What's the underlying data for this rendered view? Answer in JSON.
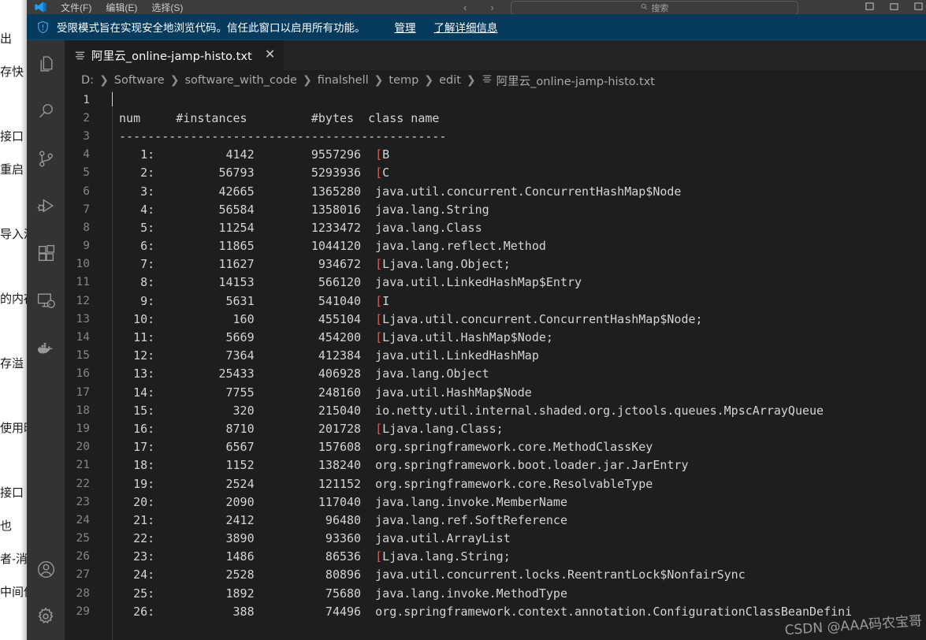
{
  "background_window": {
    "fragments": [
      "出",
      "存快",
      "",
      "接口",
      "重启",
      "",
      "导入泸",
      "",
      "的内存",
      "",
      "存溢",
      "",
      "使用时",
      "",
      "接口",
      "也",
      "者-消",
      "中间件"
    ]
  },
  "titlebar": {
    "menus": [
      "文件(F)",
      "编辑(E)",
      "选择(S)"
    ],
    "nav_back": "‹",
    "nav_forward": "›",
    "search_placeholder": "搜索",
    "search_icon": "search-icon",
    "window_controls": [
      "minimize",
      "maximize",
      "close"
    ]
  },
  "trust_banner": {
    "icon": "shield-warning-icon",
    "message": "受限模式旨在实现安全地浏览代码。信任此窗口以启用所有功能。",
    "manage_link": "管理",
    "learn_more_link": "了解详细信息"
  },
  "activity_bar": {
    "items": [
      {
        "name": "explorer",
        "icon": "files-icon"
      },
      {
        "name": "search",
        "icon": "search-icon"
      },
      {
        "name": "source-control",
        "icon": "source-control-icon"
      },
      {
        "name": "run-and-debug",
        "icon": "run-debug-icon"
      },
      {
        "name": "extensions",
        "icon": "extensions-icon"
      },
      {
        "name": "remote-explorer",
        "icon": "remote-explorer-icon"
      },
      {
        "name": "docker",
        "icon": "docker-icon"
      }
    ],
    "bottom_items": [
      {
        "name": "accounts",
        "icon": "account-icon"
      },
      {
        "name": "manage",
        "icon": "gear-icon"
      }
    ]
  },
  "editor": {
    "tab": {
      "label": "阿里云_online-jamp-histo.txt",
      "icon": "text-file-icon",
      "close_label": "✕"
    },
    "breadcrumb": [
      "D:",
      "Software",
      "software_with_code",
      "finalshell",
      "temp",
      "edit",
      "阿里云_online-jamp-histo.txt"
    ],
    "breadcrumb_separator": "❯",
    "colors": {
      "background": "#1e1e1e",
      "foreground": "#d4d4d4",
      "line_number": "#858585",
      "accent_red": "#e05a5a",
      "banner": "#063b5e"
    },
    "lines": [
      {
        "n": 1,
        "active": true,
        "cursor": true,
        "text": ""
      },
      {
        "n": 2,
        "text": " num     #instances         #bytes  class name"
      },
      {
        "n": 3,
        "text": " ----------------------------------------------"
      },
      {
        "n": 4,
        "num": "1:",
        "instances": "4142",
        "bytes": "9557296",
        "cls": "[B",
        "bracket": true
      },
      {
        "n": 5,
        "num": "2:",
        "instances": "56793",
        "bytes": "5293936",
        "cls": "[C",
        "bracket": true
      },
      {
        "n": 6,
        "num": "3:",
        "instances": "42665",
        "bytes": "1365280",
        "cls": "java.util.concurrent.ConcurrentHashMap$Node",
        "bracket": false
      },
      {
        "n": 7,
        "num": "4:",
        "instances": "56584",
        "bytes": "1358016",
        "cls": "java.lang.String",
        "bracket": false
      },
      {
        "n": 8,
        "num": "5:",
        "instances": "11254",
        "bytes": "1233472",
        "cls": "java.lang.Class",
        "bracket": false
      },
      {
        "n": 9,
        "num": "6:",
        "instances": "11865",
        "bytes": "1044120",
        "cls": "java.lang.reflect.Method",
        "bracket": false
      },
      {
        "n": 10,
        "num": "7:",
        "instances": "11627",
        "bytes": "934672",
        "cls": "[Ljava.lang.Object;",
        "bracket": true
      },
      {
        "n": 11,
        "num": "8:",
        "instances": "14153",
        "bytes": "566120",
        "cls": "java.util.LinkedHashMap$Entry",
        "bracket": false
      },
      {
        "n": 12,
        "num": "9:",
        "instances": "5631",
        "bytes": "541040",
        "cls": "[I",
        "bracket": true
      },
      {
        "n": 13,
        "num": "10:",
        "instances": "160",
        "bytes": "455104",
        "cls": "[Ljava.util.concurrent.ConcurrentHashMap$Node;",
        "bracket": true
      },
      {
        "n": 14,
        "num": "11:",
        "instances": "5669",
        "bytes": "454200",
        "cls": "[Ljava.util.HashMap$Node;",
        "bracket": true
      },
      {
        "n": 15,
        "num": "12:",
        "instances": "7364",
        "bytes": "412384",
        "cls": "java.util.LinkedHashMap",
        "bracket": false
      },
      {
        "n": 16,
        "num": "13:",
        "instances": "25433",
        "bytes": "406928",
        "cls": "java.lang.Object",
        "bracket": false
      },
      {
        "n": 17,
        "num": "14:",
        "instances": "7755",
        "bytes": "248160",
        "cls": "java.util.HashMap$Node",
        "bracket": false
      },
      {
        "n": 18,
        "num": "15:",
        "instances": "320",
        "bytes": "215040",
        "cls": "io.netty.util.internal.shaded.org.jctools.queues.MpscArrayQueue",
        "bracket": false
      },
      {
        "n": 19,
        "num": "16:",
        "instances": "8710",
        "bytes": "201728",
        "cls": "[Ljava.lang.Class;",
        "bracket": true
      },
      {
        "n": 20,
        "num": "17:",
        "instances": "6567",
        "bytes": "157608",
        "cls": "org.springframework.core.MethodClassKey",
        "bracket": false
      },
      {
        "n": 21,
        "num": "18:",
        "instances": "1152",
        "bytes": "138240",
        "cls": "org.springframework.boot.loader.jar.JarEntry",
        "bracket": false
      },
      {
        "n": 22,
        "num": "19:",
        "instances": "2524",
        "bytes": "121152",
        "cls": "org.springframework.core.ResolvableType",
        "bracket": false
      },
      {
        "n": 23,
        "num": "20:",
        "instances": "2090",
        "bytes": "117040",
        "cls": "java.lang.invoke.MemberName",
        "bracket": false
      },
      {
        "n": 24,
        "num": "21:",
        "instances": "2412",
        "bytes": "96480",
        "cls": "java.lang.ref.SoftReference",
        "bracket": false
      },
      {
        "n": 25,
        "num": "22:",
        "instances": "3890",
        "bytes": "93360",
        "cls": "java.util.ArrayList",
        "bracket": false
      },
      {
        "n": 26,
        "num": "23:",
        "instances": "1486",
        "bytes": "86536",
        "cls": "[Ljava.lang.String;",
        "bracket": true
      },
      {
        "n": 27,
        "num": "24:",
        "instances": "2528",
        "bytes": "80896",
        "cls": "java.util.concurrent.locks.ReentrantLock$NonfairSync",
        "bracket": false
      },
      {
        "n": 28,
        "num": "25:",
        "instances": "1892",
        "bytes": "75680",
        "cls": "java.lang.invoke.MethodType",
        "bracket": false
      },
      {
        "n": 29,
        "num": "26:",
        "instances": "388",
        "bytes": "74496",
        "cls": "org.springframework.context.annotation.ConfigurationClassBeanDefini",
        "bracket": false
      }
    ]
  },
  "watermark": "CSDN @AAA码农宝哥"
}
